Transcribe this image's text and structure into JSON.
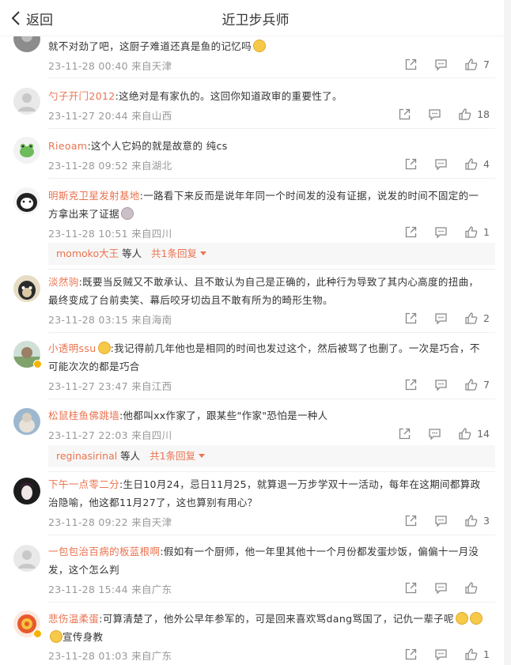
{
  "header": {
    "back_label": "返回",
    "title": "近卫步兵师"
  },
  "comments": [
    {
      "name": "",
      "text": "就不对劲了吧，这厨子难道还真是鱼的记忆吗",
      "meta": "23-11-28 00:40 来自天津",
      "likes": "7"
    },
    {
      "name": "勺子开门2012",
      "text": ":这绝对是有家仇的。这回你知道政审的重要性了。",
      "meta": "23-11-27 20:44 来自山西",
      "likes": "18"
    },
    {
      "name": "Rieoam",
      "text": ":这个人它妈的就是故意的 纯cs",
      "meta": "23-11-28 09:52 来自湖北",
      "likes": "4"
    },
    {
      "name": "明斯克卫星发射基地",
      "text": ":一路看下来反而是说年年同一个时间发的没有证据，说发的时间不固定的一方拿出来了证据",
      "meta": "23-11-28 10:51 来自四川",
      "likes": "1",
      "reply_user": "momoko大王",
      "reply_mid": " 等人 ",
      "reply_more": "共1条回复"
    },
    {
      "name": "淡然驹",
      "text": ":既要当反贼又不敢承认、且不敢认为自己是正确的，此种行为导致了其内心高度的扭曲，最终变成了台前卖笑、幕后咬牙切齿且不敢有所为的畸形生物。",
      "meta": "23-11-28 03:15 来自海南",
      "likes": "2"
    },
    {
      "name": "小透明ssu",
      "text": ":我记得前几年他也是相同的时间也发过这个，然后被骂了也删了。一次是巧合，不可能次次的都是巧合",
      "meta": "23-11-27 23:47 来自江西",
      "likes": "7"
    },
    {
      "name": "松鼠桂鱼佛跳墙",
      "text": ":他都叫xx作家了，跟某些\"作家\"恐怕是一种人",
      "meta": "23-11-27 22:03 来自四川",
      "likes": "14",
      "reply_user": "reginasirinal",
      "reply_mid": " 等人 ",
      "reply_more": "共1条回复"
    },
    {
      "name": "下午一点零二分",
      "text": ":生日10月24，忌日11月25，就算退一万步学双十一活动，每年在这期间都算政治隐喻，他这都11月27了，这也算别有用心？",
      "meta": "23-11-28 09:22 来自天津",
      "likes": "3"
    },
    {
      "name": "一包包治百病的板蓝根啊",
      "text": ":假如有一个厨师，他一年里其他十一个月份都发蛋炒饭，偏偏十一月没发，这个怎么判",
      "meta": "23-11-28 15:44 来自广东",
      "likes": ""
    },
    {
      "name": "悲伤温柔蛋",
      "text": ":可算清楚了，他外公早年参军的，可是回来喜欢骂dang骂国了，记仇一辈子呢",
      "text2": "宣传身教",
      "meta": "23-11-28 01:03 来自广东",
      "likes": "1"
    }
  ],
  "colors": {
    "name": "#eb7350",
    "meta": "#999999",
    "text": "#333333",
    "reply_bg": "#f7f7f7"
  }
}
